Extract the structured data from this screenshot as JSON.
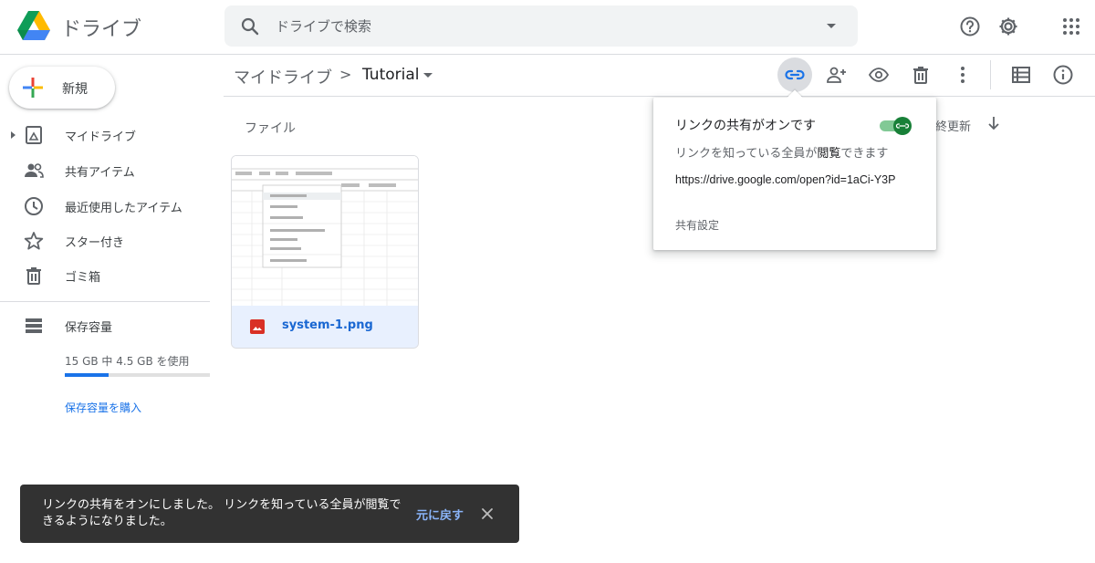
{
  "header": {
    "app_title": "ドライブ",
    "search_placeholder": "ドライブで検索",
    "icons": [
      "help-icon",
      "settings-icon",
      "apps-grid-icon"
    ]
  },
  "sidebar": {
    "new_label": "新規",
    "items": [
      {
        "label": "マイドライブ",
        "icon": "my-drive-icon"
      },
      {
        "label": "共有アイテム",
        "icon": "shared-people-icon"
      },
      {
        "label": "最近使用したアイテム",
        "icon": "clock-icon"
      },
      {
        "label": "スター付き",
        "icon": "star-icon"
      },
      {
        "label": "ゴミ箱",
        "icon": "trash-icon"
      }
    ],
    "storage": {
      "label": "保存容量",
      "usage_text": "15 GB 中 4.5 GB を使用",
      "used_fraction": 0.3,
      "buy_label": "保存容量を購入"
    }
  },
  "toolbar": {
    "breadcrumb_root": "マイドライブ",
    "breadcrumb_sep": ">",
    "breadcrumb_current": "Tutorial",
    "icons": [
      "link-icon",
      "add-person-icon",
      "preview-eye-icon",
      "delete-icon",
      "more-vert-icon",
      "list-view-icon",
      "info-icon"
    ]
  },
  "content": {
    "section_label": "ファイル",
    "sort_label": "終更新",
    "files": [
      {
        "name": "system-1.png",
        "type_icon": "image-file-icon"
      }
    ]
  },
  "share_popup": {
    "title": "リンクの共有がオンです",
    "subtitle_prefix": "リンクを知っている全員が",
    "subtitle_role": "閲覧",
    "subtitle_suffix": "できます",
    "url": "https://drive.google.com/open?id=1aCi-Y3P",
    "settings_label": "共有設定",
    "toggle_on": true
  },
  "snackbar": {
    "message": "リンクの共有をオンにしました。 リンクを知っている全員が閲覧できるようになりました。",
    "undo_label": "元に戻す"
  },
  "colors": {
    "accent_blue": "#1a73e8",
    "toggle_green": "#188038",
    "snackbar_bg": "#323232"
  }
}
